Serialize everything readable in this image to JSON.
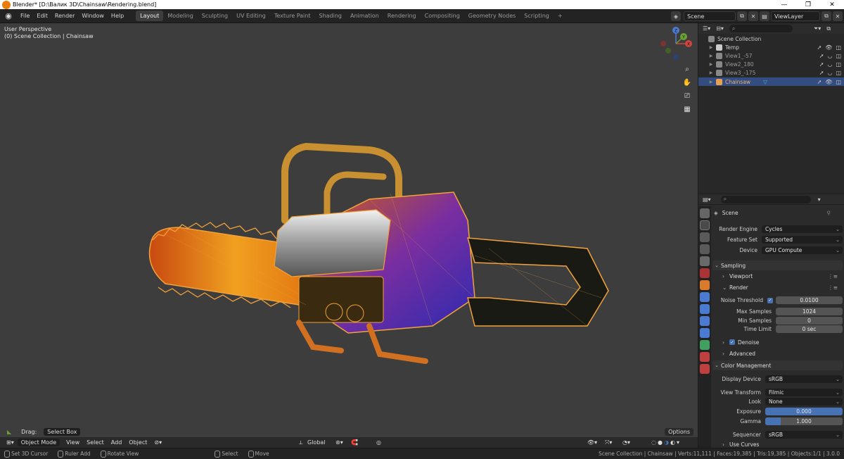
{
  "window": {
    "title": "Blender* [D:\\Валик 3D\\Chainsaw\\Rendering.blend]",
    "controls": [
      "—",
      "❐",
      "✕"
    ]
  },
  "menu": [
    "File",
    "Edit",
    "Render",
    "Window",
    "Help"
  ],
  "workspaces": [
    "Layout",
    "Modeling",
    "Sculpting",
    "UV Editing",
    "Texture Paint",
    "Shading",
    "Animation",
    "Rendering",
    "Compositing",
    "Geometry Nodes",
    "Scripting",
    "+"
  ],
  "active_workspace": "Layout",
  "scene_selector": "Scene",
  "view_layer": "ViewLayer",
  "viewport": {
    "view_name": "User Perspective",
    "collection_info": "(0) Scene Collection | Chainsaw",
    "gizmo_labels": {
      "z": "Z",
      "x": "X",
      "y": "Y"
    },
    "drag_label": "Drag:",
    "drag_value": "Select Box",
    "options": "Options"
  },
  "header": {
    "mode": "Object Mode",
    "items": [
      "View",
      "Select",
      "Add",
      "Object"
    ],
    "orientation": "Global"
  },
  "outliner": {
    "search_placeholder": "",
    "root": "Scene Collection",
    "rows": [
      {
        "name": "Temp"
      },
      {
        "name": "View1_-57"
      },
      {
        "name": "View2_180"
      },
      {
        "name": "View3_-175"
      },
      {
        "name": "Chainsaw"
      }
    ]
  },
  "properties": {
    "context": "Scene",
    "render_engine_label": "Render Engine",
    "render_engine": "Cycles",
    "feature_set_label": "Feature Set",
    "feature_set": "Supported",
    "device_label": "Device",
    "device": "GPU Compute",
    "sampling": "Sampling",
    "viewport_sub": "Viewport",
    "render_sub": "Render",
    "noise_threshold_label": "Noise Threshold",
    "noise_threshold": "0.0100",
    "max_samples_label": "Max Samples",
    "max_samples": "1024",
    "min_samples_label": "Min Samples",
    "min_samples": "0",
    "time_limit_label": "Time Limit",
    "time_limit": "0 sec",
    "denoise": "Denoise",
    "advanced": "Advanced",
    "color_management": "Color Management",
    "display_device_label": "Display Device",
    "display_device": "sRGB",
    "view_transform_label": "View Transform",
    "view_transform": "Filmic",
    "look_label": "Look",
    "look": "None",
    "exposure_label": "Exposure",
    "exposure": "0.000",
    "exposure_fill": 1.0,
    "gamma_label": "Gamma",
    "gamma": "1.000",
    "gamma_fill": 0.2,
    "sequencer_label": "Sequencer",
    "sequencer": "sRGB",
    "use_curves": "Use Curves"
  },
  "statusbar": {
    "items": [
      "Set 3D Cursor",
      "Ruler Add",
      "Rotate View",
      "Select",
      "Move"
    ],
    "stats": "Scene Collection | Chainsaw | Verts:11,111 | Faces:19,385 | Tris:19,385 | Objects:1/1 | 3.0.0"
  },
  "colors": {
    "selection": "#334d80",
    "accent": "#4772b3",
    "wire": "#f2a23a",
    "viewport_bg": "#3d3d3d"
  }
}
